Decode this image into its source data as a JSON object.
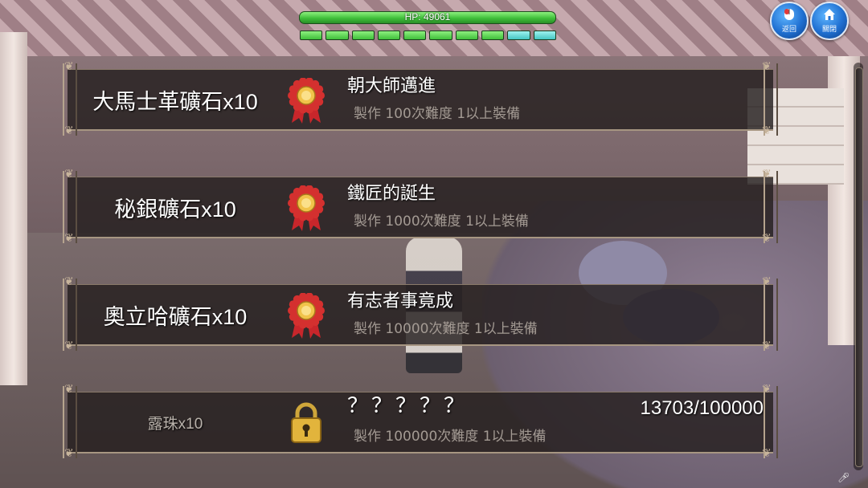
{
  "hud": {
    "hp_text": "HP: 49061",
    "hp_fraction": 1.0,
    "segments": [
      "green",
      "green",
      "green",
      "green",
      "green",
      "green",
      "green",
      "green",
      "cyan",
      "cyan"
    ]
  },
  "buttons": {
    "back": {
      "label": "返回",
      "icon": "mouse-icon"
    },
    "close": {
      "label": "關閉",
      "icon": "home-icon"
    }
  },
  "achievements": [
    {
      "reward": "大馬士革礦石x10",
      "icon": "medal-icon",
      "title": "朝大師邁進",
      "description": "製作  100次難度  1以上裝備",
      "locked": false,
      "progress": ""
    },
    {
      "reward": "秘銀礦石x10",
      "icon": "medal-icon",
      "title": "鐵匠的誕生",
      "description": "製作  1000次難度  1以上裝備",
      "locked": false,
      "progress": ""
    },
    {
      "reward": "奧立哈礦石x10",
      "icon": "medal-icon",
      "title": "有志者事竟成",
      "description": "製作  10000次難度  1以上裝備",
      "locked": false,
      "progress": ""
    },
    {
      "reward": "露珠x10",
      "icon": "lock-icon",
      "title": "？？？？？",
      "description": "製作  100000次難度  1以上裝備",
      "locked": true,
      "progress": "13703/100000"
    }
  ],
  "colors": {
    "hp_green": "#3fbf3a",
    "button_blue": "#1f6fd1",
    "row_bg": "#241e1e",
    "frame_gold": "#b6a48e"
  }
}
